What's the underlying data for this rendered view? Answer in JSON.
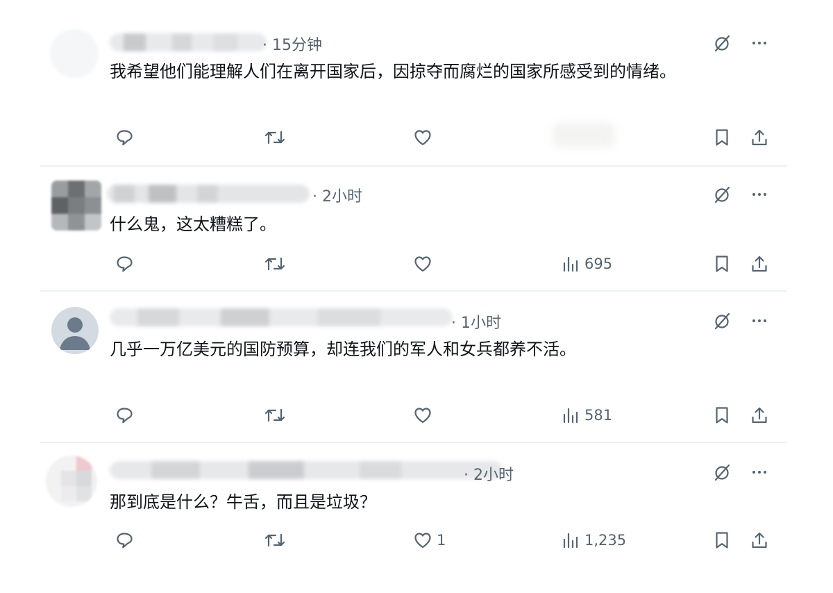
{
  "posts": [
    {
      "time": "· 15分钟",
      "text": "我希望他们能理解人们在离开国家后，因掠夺而腐烂的国家所感受到的情绪。",
      "likes": "",
      "views": ""
    },
    {
      "time": "· 2小时",
      "text": "什么鬼，这太糟糕了。",
      "likes": "",
      "views": "695"
    },
    {
      "time": "· 1小时",
      "text": "几乎一万亿美元的国防预算，却连我们的军人和女兵都养不活。",
      "likes": "",
      "views": "581"
    },
    {
      "time": "· 2小时",
      "text": "那到底是什么？牛舌，而且是垃圾？",
      "likes": "1",
      "views": "1,235"
    }
  ],
  "icons": {
    "reply": "reply-icon",
    "repost": "repost-icon",
    "like": "heart-icon",
    "views": "views-icon",
    "bookmark": "bookmark-icon",
    "share": "share-icon",
    "grok": "grok-icon",
    "more": "more-icon"
  },
  "colors": {
    "text": "#0f1419",
    "muted": "#536471",
    "separator": "#eef1f3",
    "avatar_default": "#d3dae2",
    "avatar_figure": "#6b7b8c"
  }
}
